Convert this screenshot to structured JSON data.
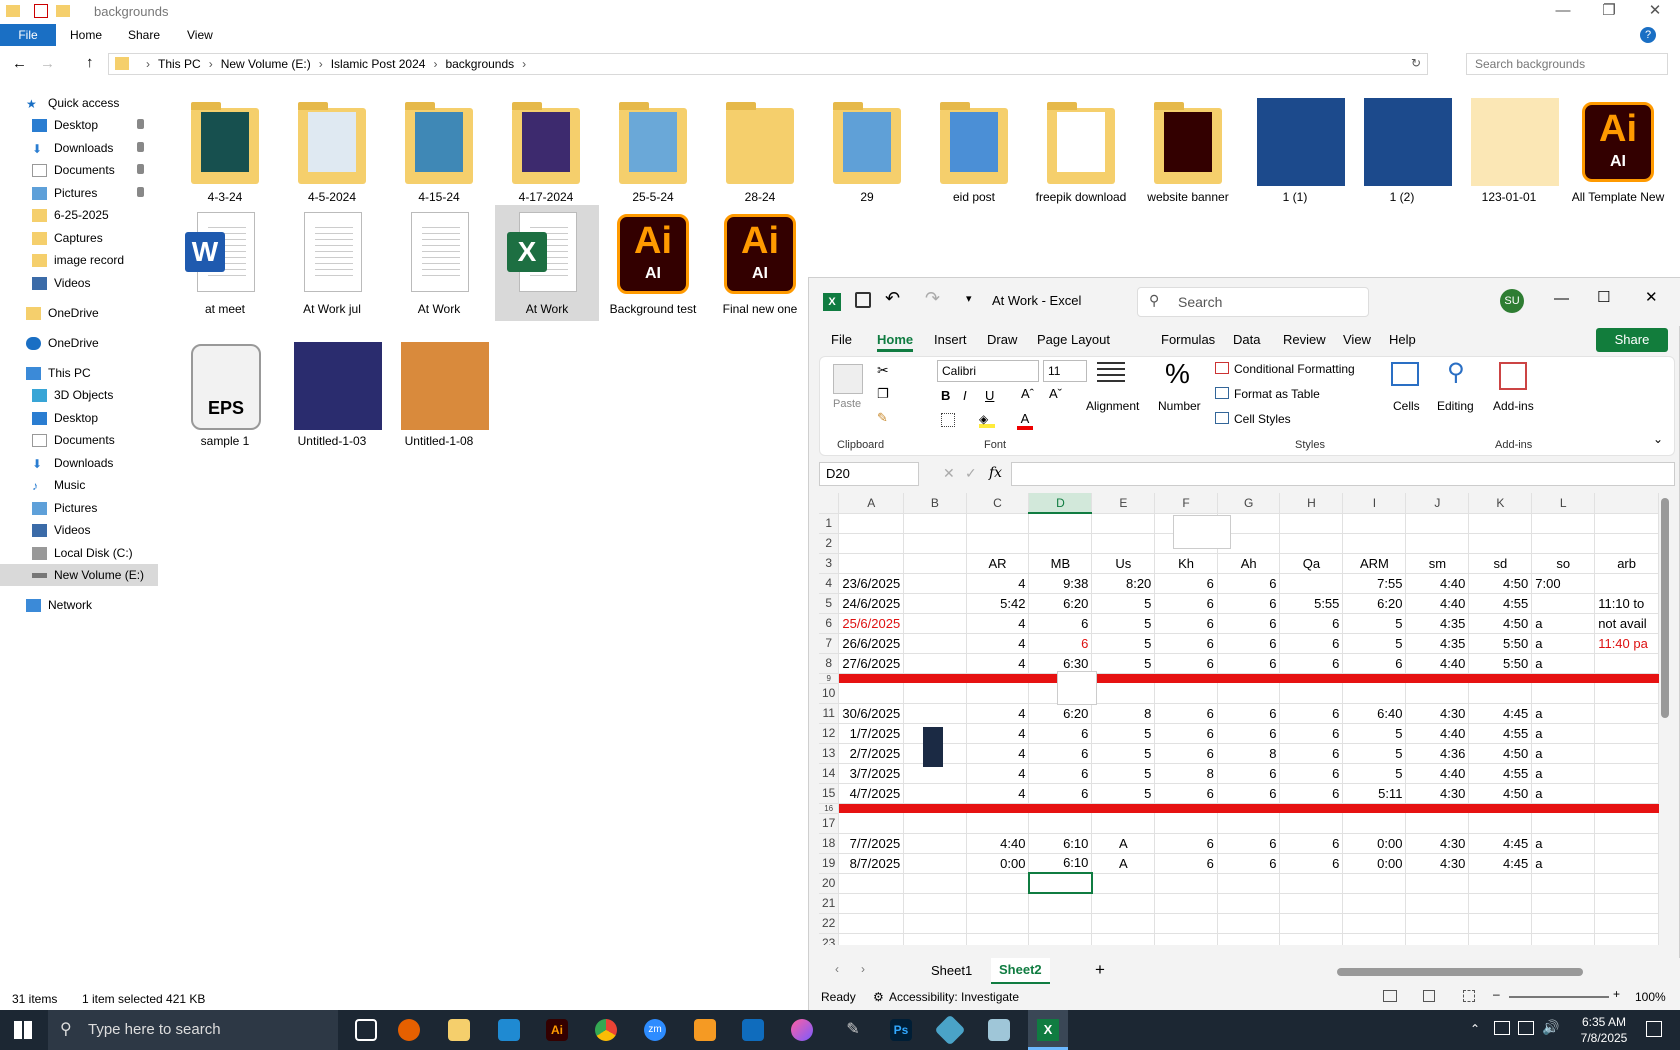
{
  "explorer": {
    "title": "backgrounds",
    "ribbon_tabs": [
      "File",
      "Home",
      "Share",
      "View"
    ],
    "breadcrumbs": [
      "This PC",
      "New Volume (E:)",
      "Islamic Post 2024",
      "backgrounds"
    ],
    "search_placeholder": "Search backgrounds",
    "nav": {
      "quick_access": "Quick access",
      "quick_items": [
        "Desktop",
        "Downloads",
        "Documents",
        "Pictures",
        "6-25-2025",
        "Captures",
        "image record",
        "Videos"
      ],
      "onedrive1": "OneDrive",
      "onedrive2": "OneDrive",
      "this_pc": "This PC",
      "pc_items": [
        "3D Objects",
        "Desktop",
        "Documents",
        "Downloads",
        "Music",
        "Pictures",
        "Videos",
        "Local Disk (C:)",
        "New Volume (E:)"
      ],
      "network": "Network"
    },
    "row1": [
      "4-3-24",
      "4-5-2024",
      "4-15-24",
      "4-17-2024",
      "25-5-24",
      "28-24",
      "29",
      "eid post",
      "freepik download",
      "website banner",
      "1 (1)",
      "1 (2)",
      "123-01-01",
      "All Template New"
    ],
    "row2": [
      "at meet",
      "At Work jul",
      "At Work",
      "At Work",
      "Background test",
      "Final new one"
    ],
    "row3": [
      "sample 1",
      "Untitled-1-03",
      "Untitled-1-08"
    ],
    "ai_label": "Ai",
    "ai_sub": "AI",
    "eps_label": "EPS",
    "word_letter": "W",
    "excel_letter": "X",
    "status_count": "31 items",
    "status_selected": "1 item selected  421 KB"
  },
  "excel": {
    "title": "At Work  -  Excel",
    "search": "Search",
    "avatar": "SU",
    "tabs": [
      "File",
      "Home",
      "Insert",
      "Draw",
      "Page Layout",
      "Formulas",
      "Data",
      "Review",
      "View",
      "Help"
    ],
    "share": "Share",
    "paste": "Paste",
    "font_name": "Calibri",
    "font_size": "11",
    "cond_format": "Conditional Formatting",
    "format_table": "Format as Table",
    "cell_styles": "Cell Styles",
    "alignment": "Alignment",
    "number": "Number",
    "cells": "Cells",
    "editing": "Editing",
    "addins": "Add-ins",
    "group_labels": [
      "Clipboard",
      "Font",
      "Styles",
      "Add-ins"
    ],
    "name_box": "D20",
    "fx": "fx",
    "columns": [
      "A",
      "B",
      "C",
      "D",
      "E",
      "F",
      "G",
      "H",
      "I",
      "J",
      "K",
      "L"
    ],
    "rows": [
      {
        "n": "1",
        "cells": [
          "",
          "",
          "",
          "",
          "",
          "",
          "",
          "",
          "",
          "",
          "",
          "",
          ""
        ]
      },
      {
        "n": "2",
        "cells": [
          "",
          "",
          "",
          "",
          "",
          "",
          "",
          "",
          "",
          "",
          "",
          "",
          ""
        ]
      },
      {
        "n": "3",
        "cells": [
          "",
          "",
          "AR",
          "MB",
          "Us",
          "Kh",
          "Ah",
          "Qa",
          "ARM",
          "sm",
          "sd",
          "so",
          "arb"
        ]
      },
      {
        "n": "4",
        "cells": [
          "23/6/2025",
          "",
          "4",
          "9:38",
          "8:20",
          "6",
          "6",
          "",
          "7:55",
          "4:40",
          "4:50",
          "7:00",
          ""
        ]
      },
      {
        "n": "5",
        "cells": [
          "24/6/2025",
          "",
          "5:42",
          "6:20",
          "5",
          "6",
          "6",
          "5:55",
          "6:20",
          "4:40",
          "4:55",
          "",
          "11:10 to"
        ]
      },
      {
        "n": "6",
        "cells": [
          "25/6/2025",
          "",
          "4",
          "6",
          "5",
          "6",
          "6",
          "6",
          "5",
          "4:35",
          "4:50",
          "a",
          "not avail"
        ],
        "red_a": true
      },
      {
        "n": "7",
        "cells": [
          "26/6/2025",
          "",
          "4",
          "6",
          "5",
          "6",
          "6",
          "6",
          "5",
          "4:35",
          "5:50",
          "a",
          "11:40 pa"
        ],
        "red_m": true
      },
      {
        "n": "8",
        "cells": [
          "27/6/2025",
          "",
          "4",
          "6:30",
          "5",
          "6",
          "6",
          "6",
          "6",
          "4:40",
          "5:50",
          "a",
          ""
        ]
      },
      {
        "n": "9",
        "red": true
      },
      {
        "n": "10",
        "cells": [
          "",
          "",
          "",
          "",
          "",
          "",
          "",
          "",
          "",
          "",
          "",
          "",
          ""
        ]
      },
      {
        "n": "11",
        "cells": [
          "30/6/2025",
          "",
          "4",
          "6:20",
          "8",
          "6",
          "6",
          "6",
          "6:40",
          "4:30",
          "4:45",
          "a",
          ""
        ]
      },
      {
        "n": "12",
        "cells": [
          "1/7/2025",
          "",
          "4",
          "6",
          "5",
          "6",
          "6",
          "6",
          "5",
          "4:40",
          "4:55",
          "a",
          ""
        ]
      },
      {
        "n": "13",
        "cells": [
          "2/7/2025",
          "",
          "4",
          "6",
          "5",
          "6",
          "8",
          "6",
          "5",
          "4:36",
          "4:50",
          "a",
          ""
        ]
      },
      {
        "n": "14",
        "cells": [
          "3/7/2025",
          "",
          "4",
          "6",
          "5",
          "8",
          "6",
          "6",
          "5",
          "4:40",
          "4:55",
          "a",
          ""
        ]
      },
      {
        "n": "15",
        "cells": [
          "4/7/2025",
          "",
          "4",
          "6",
          "5",
          "6",
          "6",
          "6",
          "5:11",
          "4:30",
          "4:50",
          "a",
          ""
        ]
      },
      {
        "n": "16",
        "red": true
      },
      {
        "n": "17",
        "cells": [
          "",
          "",
          "",
          "",
          "",
          "",
          "",
          "",
          "",
          "",
          "",
          "",
          ""
        ]
      },
      {
        "n": "18",
        "cells": [
          "7/7/2025",
          "",
          "4:40",
          "6:10",
          "A",
          "6",
          "6",
          "6",
          "0:00",
          "4:30",
          "4:45",
          "a",
          ""
        ]
      },
      {
        "n": "19",
        "cells": [
          "8/7/2025",
          "",
          "0:00",
          "6:10",
          "A",
          "6",
          "6",
          "6",
          "0:00",
          "4:30",
          "4:45",
          "a",
          ""
        ]
      },
      {
        "n": "20",
        "cells": [
          "",
          "",
          "",
          "",
          "",
          "",
          "",
          "",
          "",
          "",
          "",
          "",
          ""
        ],
        "active": true
      },
      {
        "n": "21",
        "cells": [
          "",
          "",
          "",
          "",
          "",
          "",
          "",
          "",
          "",
          "",
          "",
          "",
          ""
        ]
      },
      {
        "n": "22",
        "cells": [
          "",
          "",
          "",
          "",
          "",
          "",
          "",
          "",
          "",
          "",
          "",
          "",
          ""
        ]
      },
      {
        "n": "23",
        "cells": [
          "",
          "",
          "",
          "",
          "",
          "",
          "",
          "",
          "",
          "",
          "",
          "",
          ""
        ]
      }
    ],
    "sheets": [
      "Sheet1",
      "Sheet2"
    ],
    "status_ready": "Ready",
    "status_access": "Accessibility: Investigate",
    "zoom": "100%"
  },
  "taskbar": {
    "search_placeholder": "Type here to search",
    "time": "6:35 AM",
    "date": "7/8/2025",
    "ps_label": "Ps",
    "ai_label": "Ai",
    "zm_label": "zm"
  },
  "colors": {
    "excel_green": "#107c41",
    "red_row": "#e61212",
    "explorer_blue": "#1a6fc4",
    "taskbar": "#1c2733"
  }
}
